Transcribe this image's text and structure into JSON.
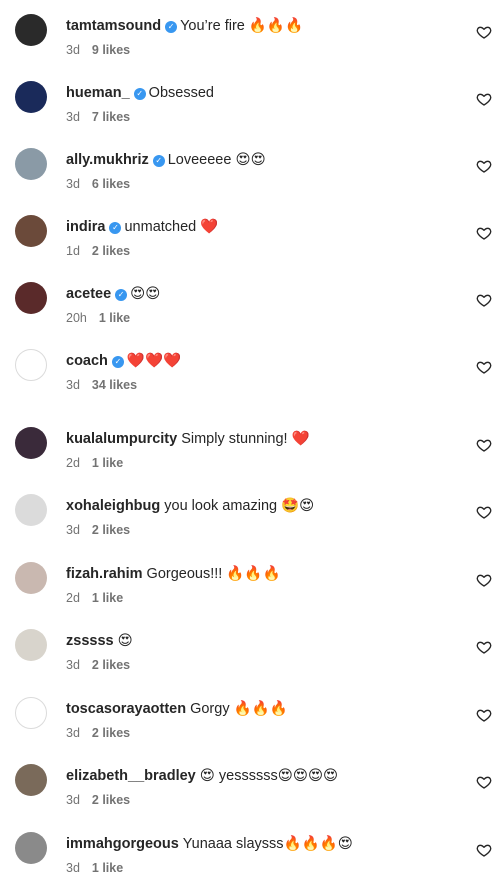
{
  "comments": [
    {
      "username": "tamtamsound",
      "verified": true,
      "text": "You’re fire 🔥🔥🔥",
      "time": "3d",
      "likes": "9 likes",
      "avatar_color": "#2a2a2a"
    },
    {
      "username": "hueman_",
      "verified": true,
      "text": "Obsessed",
      "time": "3d",
      "likes": "7 likes",
      "avatar_color": "#1a2a5a"
    },
    {
      "username": "ally.mukhriz",
      "verified": true,
      "text": "Loveeeee 😍😍",
      "time": "3d",
      "likes": "6 likes",
      "avatar_color": "#8a9aa6"
    },
    {
      "username": "indira",
      "verified": true,
      "text": "unmatched ❤️",
      "time": "1d",
      "likes": "2 likes",
      "avatar_color": "#6b4a3a"
    },
    {
      "username": "acetee",
      "verified": true,
      "text": "😍😍",
      "time": "20h",
      "likes": "1 like",
      "avatar_color": "#5a2a2a"
    },
    {
      "username": "coach",
      "verified": true,
      "text": "❤️❤️❤️",
      "time": "3d",
      "likes": "34 likes",
      "avatar_color": "#ffffff"
    },
    {
      "username": "kualalumpurcity",
      "verified": false,
      "text": "Simply stunning! ❤️",
      "time": "2d",
      "likes": "1 like",
      "avatar_color": "#3a2a3a"
    },
    {
      "username": "xohaleighbug",
      "verified": false,
      "text": "you look amazing 🤩😍",
      "time": "3d",
      "likes": "2 likes",
      "avatar_color": "#dbdbdb"
    },
    {
      "username": "fizah.rahim",
      "verified": false,
      "text": "Gorgeous!!! 🔥🔥🔥",
      "time": "2d",
      "likes": "1 like",
      "avatar_color": "#c9b8b0"
    },
    {
      "username": "zsssss",
      "verified": false,
      "text": "😍",
      "time": "3d",
      "likes": "2 likes",
      "avatar_color": "#d8d4cc"
    },
    {
      "username": "toscasorayaotten",
      "verified": false,
      "text": "Gorgy 🔥🔥🔥",
      "time": "3d",
      "likes": "2 likes",
      "avatar_color": "#ffffff"
    },
    {
      "username": "elizabeth__bradley",
      "verified": false,
      "text": "😍 yessssss😍😍😍😍",
      "time": "3d",
      "likes": "2 likes",
      "avatar_color": "#7a6a5a"
    },
    {
      "username": "immahgorgeous",
      "verified": false,
      "text": "Yunaaa slaysss🔥🔥🔥😍",
      "time": "3d",
      "likes": "1 like",
      "avatar_color": "#8a8a8a"
    }
  ],
  "icons": {
    "heart": "heart-outline-icon",
    "verified": "verified-badge-icon"
  },
  "colors": {
    "username": "#262626",
    "meta": "#737373",
    "verified": "#3897f0"
  }
}
